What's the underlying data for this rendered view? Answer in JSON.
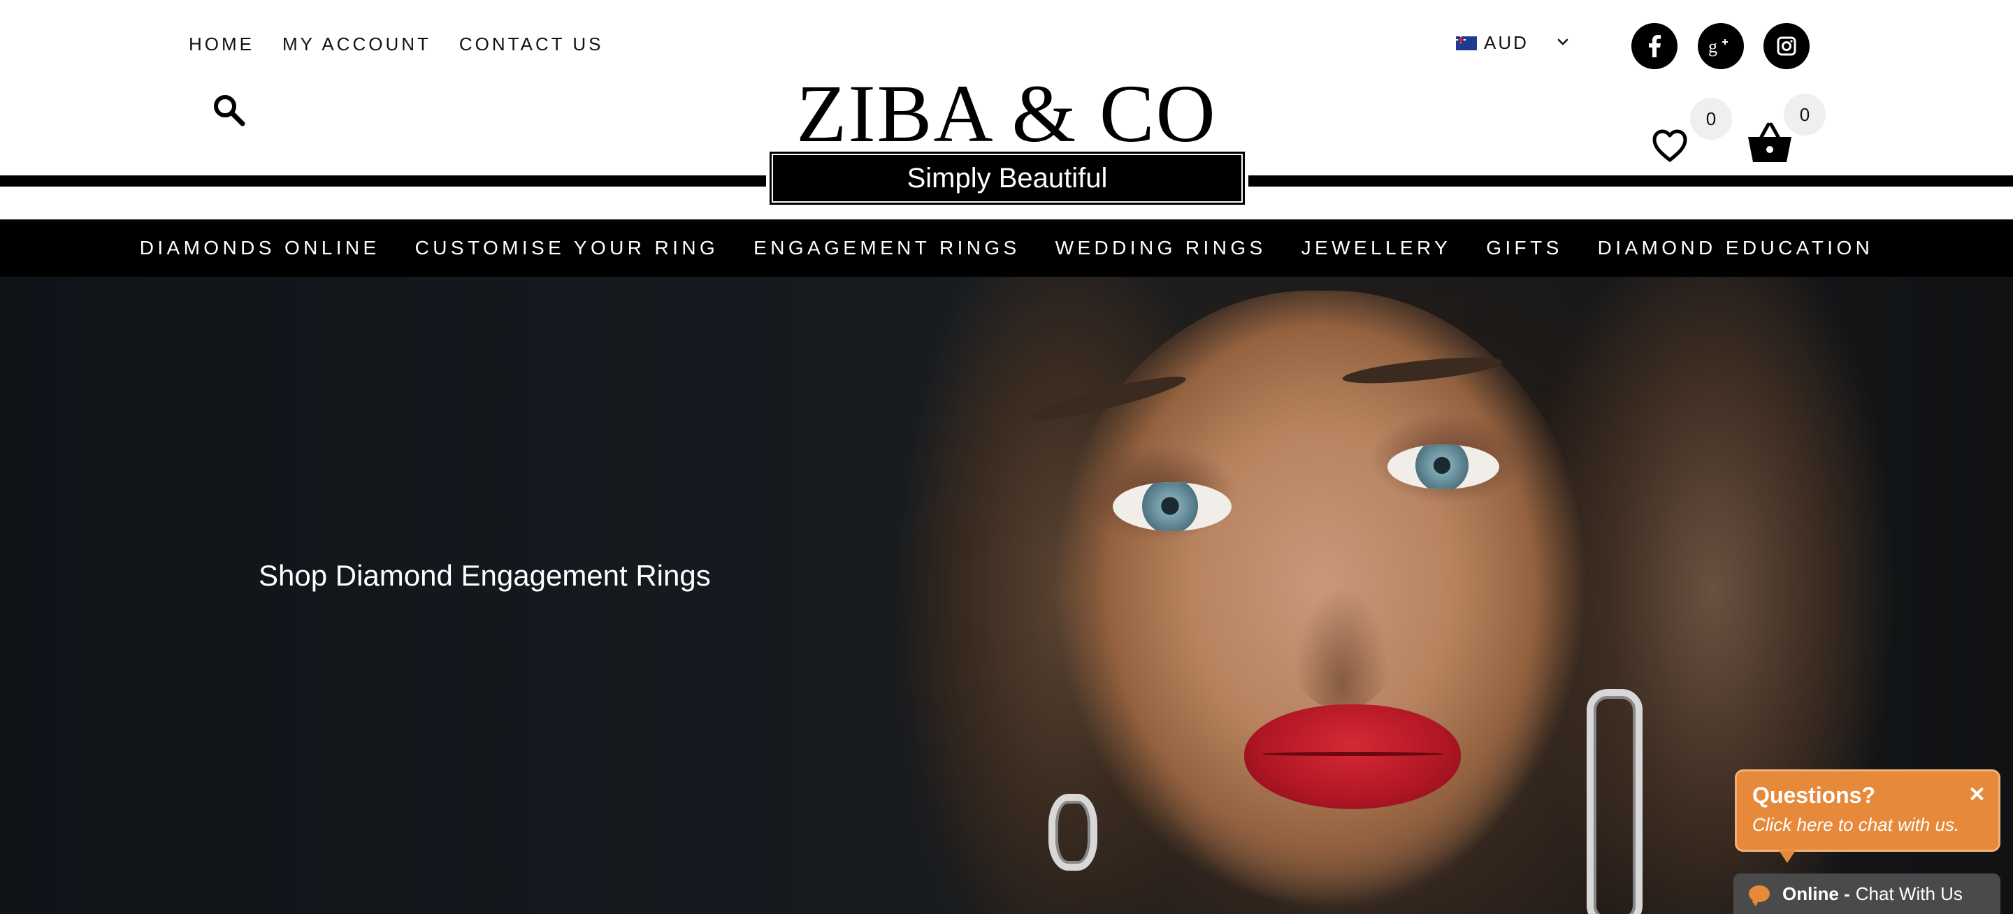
{
  "top_nav": [
    {
      "label": "HOME"
    },
    {
      "label": "MY ACCOUNT"
    },
    {
      "label": "CONTACT US"
    }
  ],
  "currency": {
    "code": "AUD",
    "flag_icon": "australia-flag-icon"
  },
  "social": [
    {
      "icon": "facebook-icon"
    },
    {
      "icon": "google-plus-icon"
    },
    {
      "icon": "instagram-icon"
    }
  ],
  "logo": {
    "title": "ZIBA & CO",
    "tagline": "Simply Beautiful"
  },
  "wishlist": {
    "count": "0"
  },
  "cart": {
    "count": "0"
  },
  "main_nav": [
    {
      "label": "DIAMONDS ONLINE"
    },
    {
      "label": "CUSTOMISE YOUR RING"
    },
    {
      "label": "ENGAGEMENT RINGS"
    },
    {
      "label": "WEDDING RINGS"
    },
    {
      "label": "JEWELLERY"
    },
    {
      "label": "GIFTS"
    },
    {
      "label": "DIAMOND EDUCATION"
    }
  ],
  "hero": {
    "title": "Shop Diamond Engagement Rings"
  },
  "chat": {
    "title": "Questions?",
    "subtitle": "Click here to chat with us.",
    "close": "✕",
    "status": "Online -",
    "bar_label": "Chat With Us",
    "accent": "#e6893a"
  }
}
